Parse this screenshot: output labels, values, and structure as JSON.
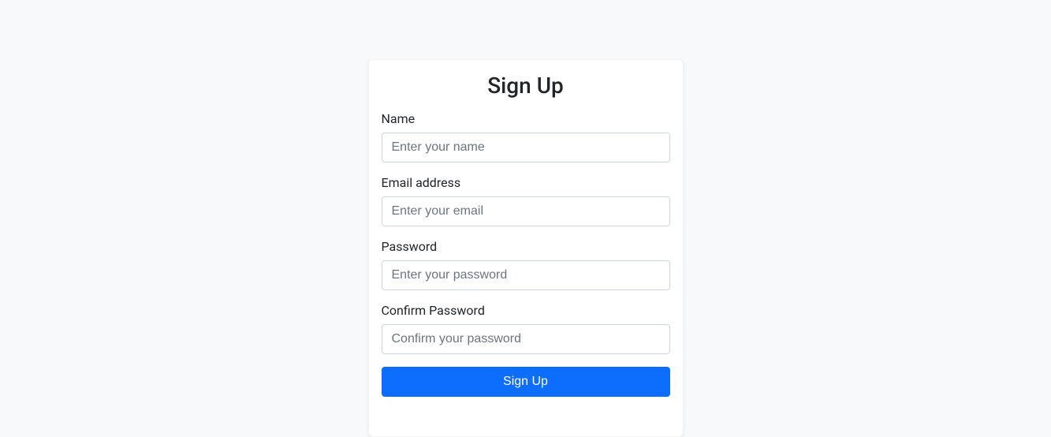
{
  "form": {
    "title": "Sign Up",
    "fields": {
      "name": {
        "label": "Name",
        "placeholder": "Enter your name",
        "value": ""
      },
      "email": {
        "label": "Email address",
        "placeholder": "Enter your email",
        "value": ""
      },
      "password": {
        "label": "Password",
        "placeholder": "Enter your password",
        "value": ""
      },
      "confirm_password": {
        "label": "Confirm Password",
        "placeholder": "Confirm your password",
        "value": ""
      }
    },
    "submit_label": "Sign Up"
  }
}
